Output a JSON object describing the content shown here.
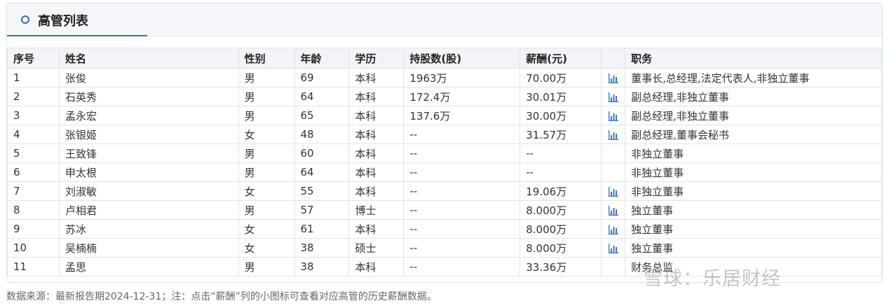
{
  "panel": {
    "title": "高管列表"
  },
  "table": {
    "headers": [
      "序号",
      "姓名",
      "性别",
      "年龄",
      "学历",
      "持股数(股)",
      "薪酬(元)",
      "",
      "职务"
    ],
    "rows": [
      {
        "idx": "1",
        "name": "张俊",
        "gender": "男",
        "age": "69",
        "edu": "本科",
        "shares": "1963万",
        "salary": "70.00万",
        "chart": true,
        "title": "董事长,总经理,法定代表人,非独立董事"
      },
      {
        "idx": "2",
        "name": "石英秀",
        "gender": "男",
        "age": "64",
        "edu": "本科",
        "shares": "172.4万",
        "salary": "30.01万",
        "chart": true,
        "title": "副总经理,非独立董事"
      },
      {
        "idx": "3",
        "name": "孟永宏",
        "gender": "男",
        "age": "65",
        "edu": "本科",
        "shares": "137.6万",
        "salary": "30.00万",
        "chart": true,
        "title": "副总经理,非独立董事"
      },
      {
        "idx": "4",
        "name": "张银姬",
        "gender": "女",
        "age": "48",
        "edu": "本科",
        "shares": "--",
        "salary": "31.57万",
        "chart": true,
        "title": "副总经理,董事会秘书"
      },
      {
        "idx": "5",
        "name": "王致锋",
        "gender": "男",
        "age": "60",
        "edu": "本科",
        "shares": "--",
        "salary": "--",
        "chart": false,
        "title": "非独立董事"
      },
      {
        "idx": "6",
        "name": "申太根",
        "gender": "男",
        "age": "64",
        "edu": "本科",
        "shares": "--",
        "salary": "--",
        "chart": false,
        "title": "非独立董事"
      },
      {
        "idx": "7",
        "name": "刘淑敏",
        "gender": "女",
        "age": "55",
        "edu": "本科",
        "shares": "--",
        "salary": "19.06万",
        "chart": true,
        "title": "非独立董事"
      },
      {
        "idx": "8",
        "name": "卢相君",
        "gender": "男",
        "age": "57",
        "edu": "博士",
        "shares": "--",
        "salary": "8.000万",
        "chart": true,
        "title": "独立董事"
      },
      {
        "idx": "9",
        "name": "苏冰",
        "gender": "女",
        "age": "61",
        "edu": "本科",
        "shares": "--",
        "salary": "8.000万",
        "chart": true,
        "title": "独立董事"
      },
      {
        "idx": "10",
        "name": "吴楠楠",
        "gender": "女",
        "age": "38",
        "edu": "硕士",
        "shares": "--",
        "salary": "8.000万",
        "chart": true,
        "title": "独立董事"
      },
      {
        "idx": "11",
        "name": "孟思",
        "gender": "男",
        "age": "38",
        "edu": "本科",
        "shares": "--",
        "salary": "33.36万",
        "chart": false,
        "title": "财务总监"
      }
    ]
  },
  "footer": {
    "note": "数据来源：最新报告期2024-12-31；注：点击“薪酬”列的小图标可查看对应高管的历史薪酬数据。"
  },
  "watermark": {
    "text": "雪球：乐居财经"
  },
  "colors": {
    "accent": "#3c6ea8",
    "chart_icon": "#3a78c3"
  }
}
